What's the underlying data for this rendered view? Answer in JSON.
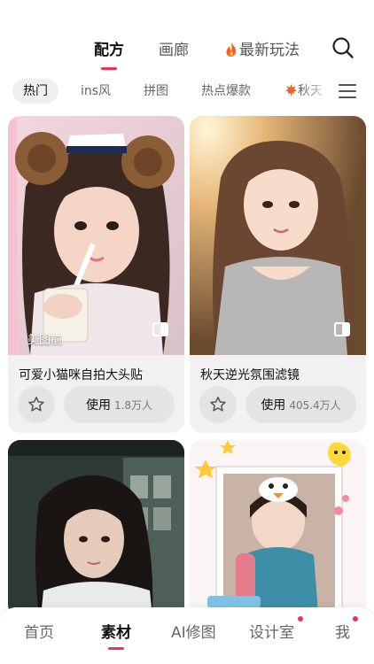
{
  "top_tabs": [
    {
      "label": "配方",
      "active": true
    },
    {
      "label": "画廊",
      "active": false
    },
    {
      "label": "最新玩法",
      "active": false,
      "icon": "flame-icon"
    }
  ],
  "search_icon": "search-icon",
  "categories": [
    "热门",
    "ins风",
    "拼图",
    "热点爆款",
    "秋天"
  ],
  "category_icon": "maple-leaf-icon",
  "menu_icon": "menu-icon",
  "cards": [
    {
      "title": "可爱小猫咪自拍大头贴",
      "before_label": "美图前",
      "use_label": "使用",
      "use_count": "1.8万人"
    },
    {
      "title": "秋天逆光氛围滤镜",
      "before_label": "",
      "use_label": "使用",
      "use_count": "405.4万人"
    },
    {
      "title": "",
      "before_label": "",
      "use_label": "",
      "use_count": ""
    },
    {
      "title": "",
      "before_label": "",
      "use_label": "",
      "use_count": ""
    }
  ],
  "bottom_nav": [
    {
      "label": "首页",
      "active": false
    },
    {
      "label": "素材",
      "active": true
    },
    {
      "label": "AI修图",
      "active": false
    },
    {
      "label": "设计室",
      "active": false,
      "badge": true
    },
    {
      "label": "我",
      "active": false,
      "badge": true
    }
  ],
  "colors": {
    "accent": "#f0325a",
    "card_bg": "#f1f1f3",
    "button_bg": "#e4e4e7"
  }
}
